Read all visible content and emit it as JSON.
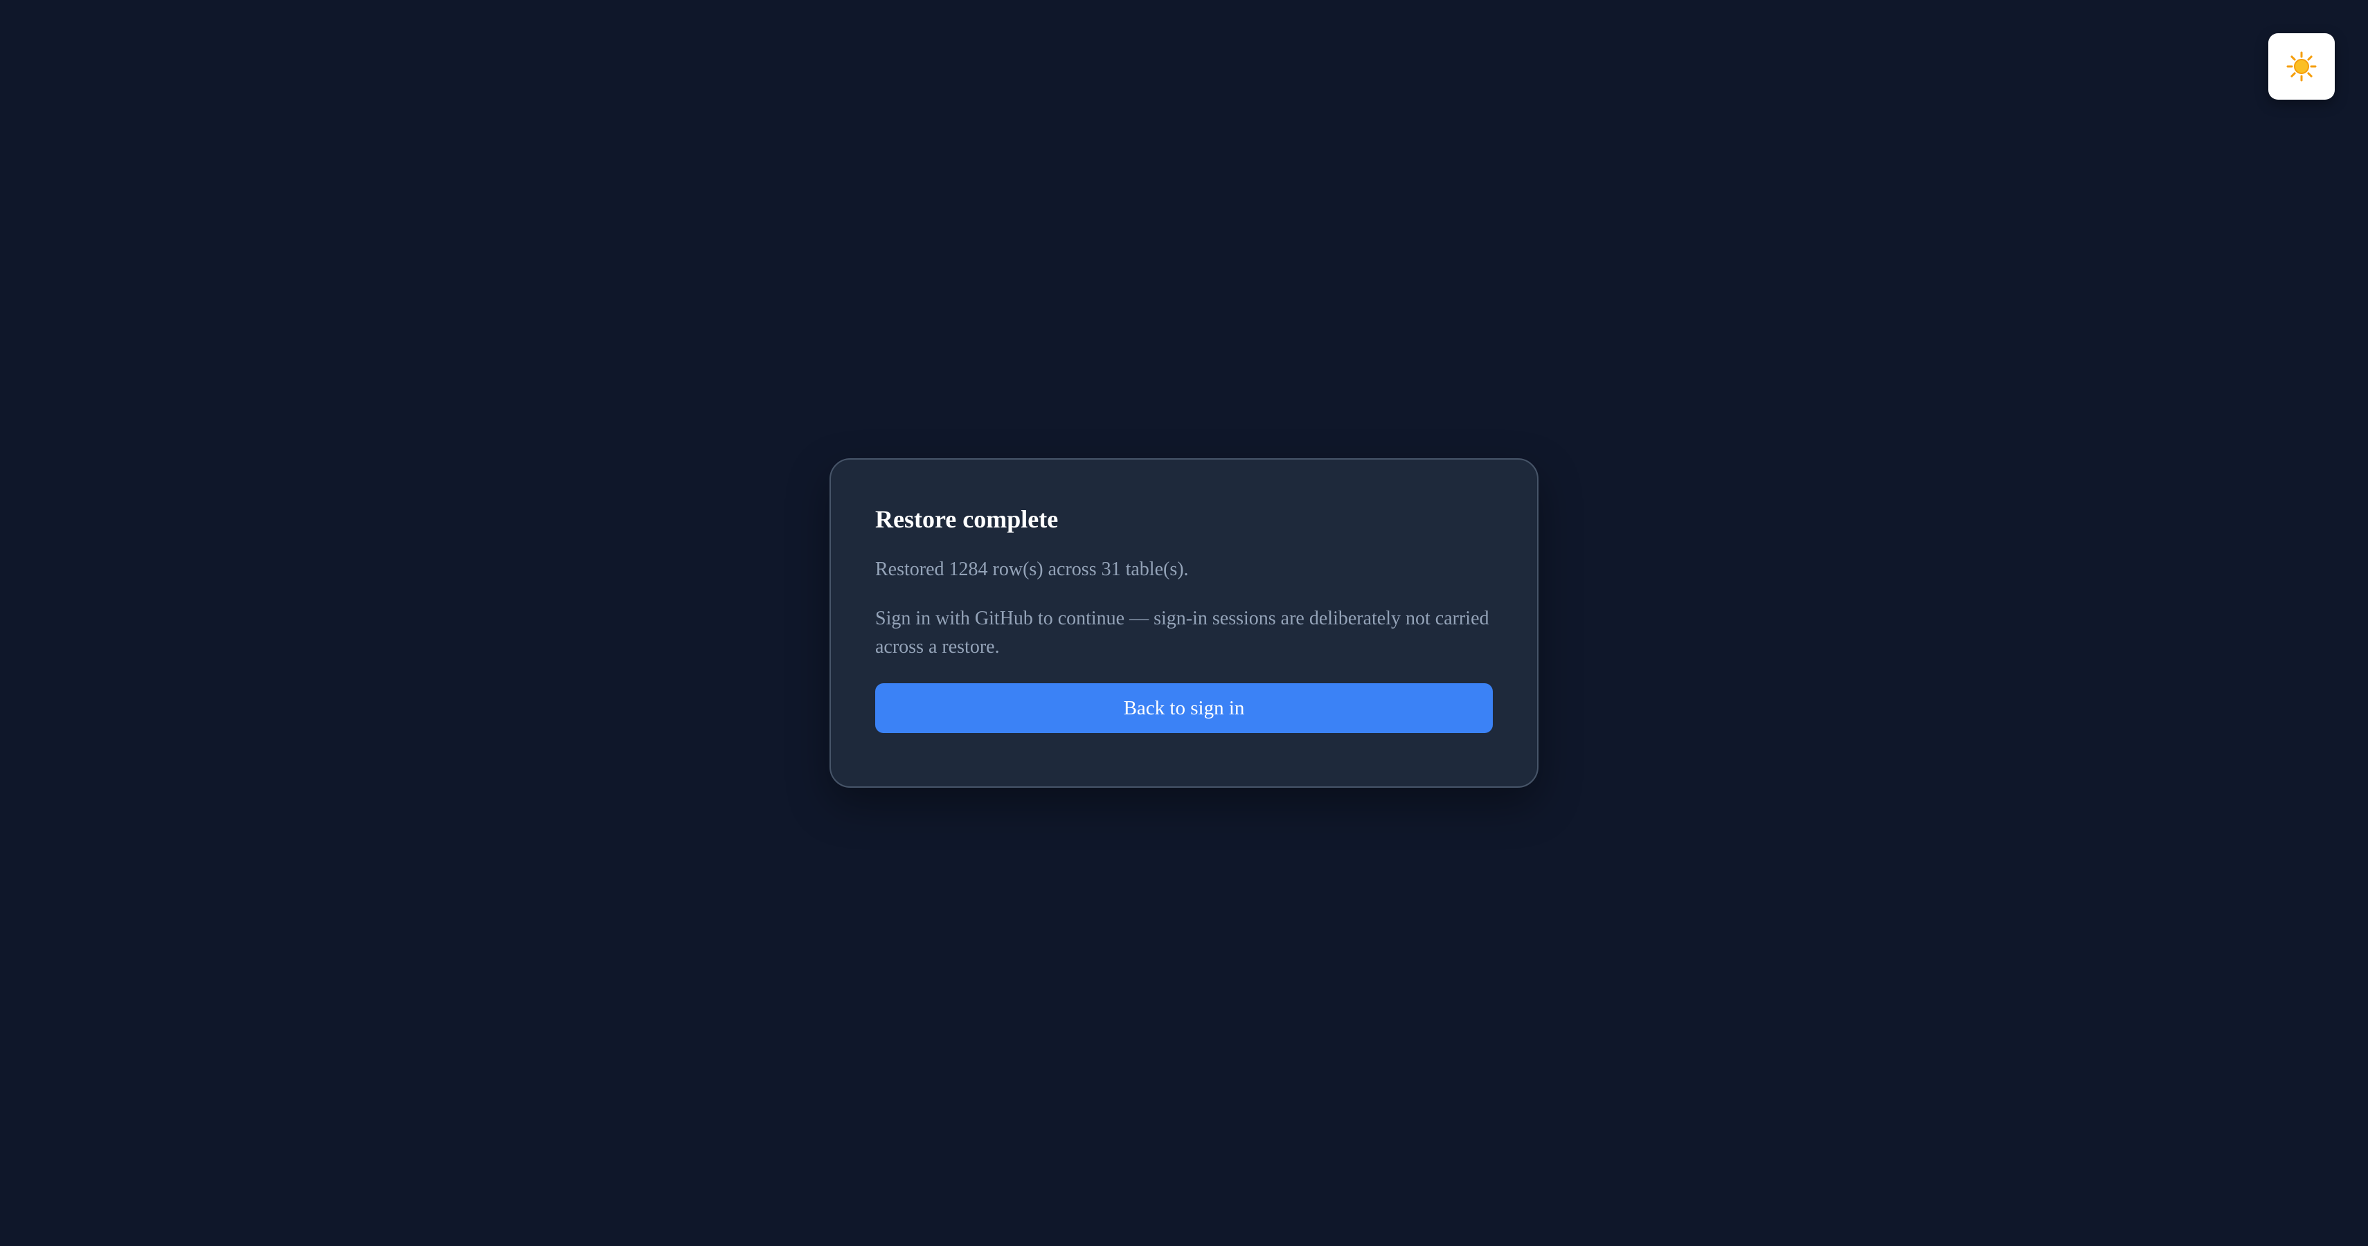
{
  "header": {
    "theme_toggle_icon": "sun-icon",
    "icon_color": "#f59e0b"
  },
  "card": {
    "title": "Restore complete",
    "summary": "Restored 1284 row(s) across 31 table(s).",
    "note": "Sign in with GitHub to continue — sign-in sessions are deliberately not carried across a restore.",
    "button_label": "Back to sign in"
  },
  "colors": {
    "background": "#0f172a",
    "card": "#1e293b",
    "card_border": "#475569",
    "accent": "#3b82f6",
    "muted_text": "#94a3b8"
  }
}
